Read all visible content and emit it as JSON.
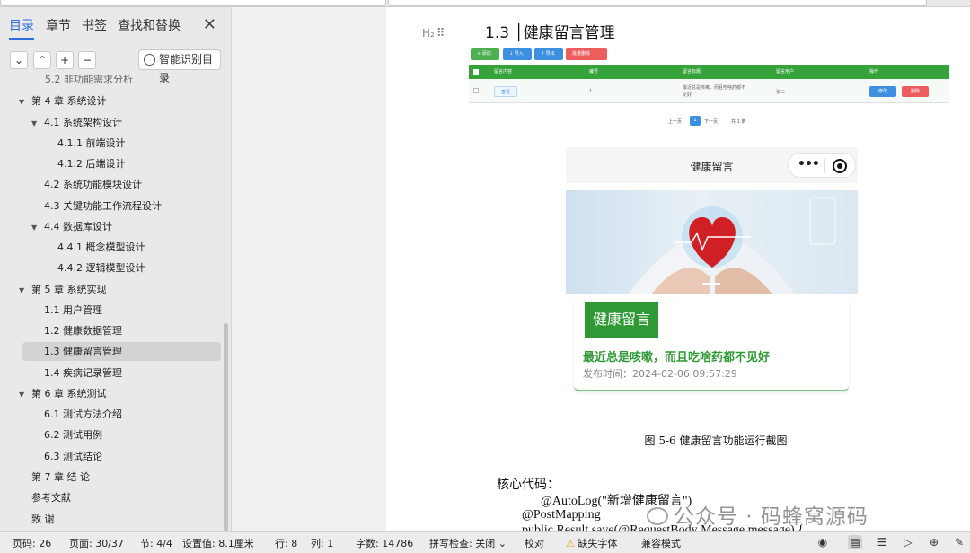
{
  "sidebar": {
    "tabs": [
      "目录",
      "章节",
      "书签",
      "查找和替换"
    ],
    "active_tab": "目录",
    "tools": {
      "expand": "⌄",
      "collapse": "⌃",
      "add": "+",
      "remove": "−"
    },
    "smart_toc_label": "智能识别目录",
    "toc": [
      "5.2 非功能需求分析",
      "第 4 章 系统设计",
      "4.1 系统架构设计",
      "4.1.1 前端设计",
      "4.1.2 后端设计",
      "4.2 系统功能模块设计",
      "4.3 关键功能工作流程设计",
      "4.4 数据库设计",
      "4.4.1 概念模型设计",
      "4.4.2 逻辑模型设计",
      "第 5 章 系统实现",
      "1.1 用户管理",
      "1.2 健康数据管理",
      "1.3 健康留言管理",
      "1.4 疾病记录管理",
      "第 6 章 系统测试",
      "6.1 测试方法介绍",
      "6.2 测试用例",
      "6.3 测试结论",
      "第 7 章 结 论",
      "参考文献",
      "致 谢"
    ]
  },
  "doc": {
    "heading_marker": "H₂",
    "heading": "1.3 │健康留言管理",
    "admin": {
      "buttons": [
        "+ 添加",
        "↓ 导入",
        "↑ 导出",
        "批量删除"
      ],
      "columns": [
        "留言内容",
        "编号",
        "留言标题",
        "留言用户",
        "操作"
      ],
      "row": {
        "view": "查看",
        "id": "1",
        "title": "最近总是咳嗽，而且吃啥药都不见好",
        "user": "张三",
        "edit": "修改",
        "delete": "删除"
      },
      "pager": {
        "prev": "上一页",
        "page": "1",
        "next": "下一页",
        "total": "共 1 条"
      }
    },
    "phone": {
      "title": "健康留言",
      "menu_dots": "•••",
      "tag": "健康留言",
      "message_title": "最近总是咳嗽，而且吃啥药都不见好",
      "publish_time": "发布时间：2024-02-06 09:57:29"
    },
    "caption": "图 5-6 健康留言功能运行截图",
    "code": [
      "核心代码：",
      "@AutoLog(\"新增健康留言\")",
      "@PostMapping",
      "public Result save(@RequestBody Message message) {"
    ],
    "watermark": "公众号 · 码蜂窝源码"
  },
  "status": {
    "page": "页码: 26",
    "page_of": "页面: 30/37",
    "section": "节: 4/4",
    "setting": "设置值: 8.1厘米",
    "line": "行: 8",
    "col": "列: 1",
    "words": "字数: 14786",
    "spell": "拼写检查: 关闭 ⌄",
    "proof": "校对",
    "missing_font": "缺失字体",
    "compat": "兼容模式"
  },
  "colors": {
    "accent": "#2a6fdb",
    "green": "#2f9a35",
    "table_header": "#36a33a"
  },
  "icons": [
    "eye-icon",
    "page-view-icon",
    "outline-view-icon",
    "play-icon",
    "globe-icon",
    "pen-icon"
  ]
}
